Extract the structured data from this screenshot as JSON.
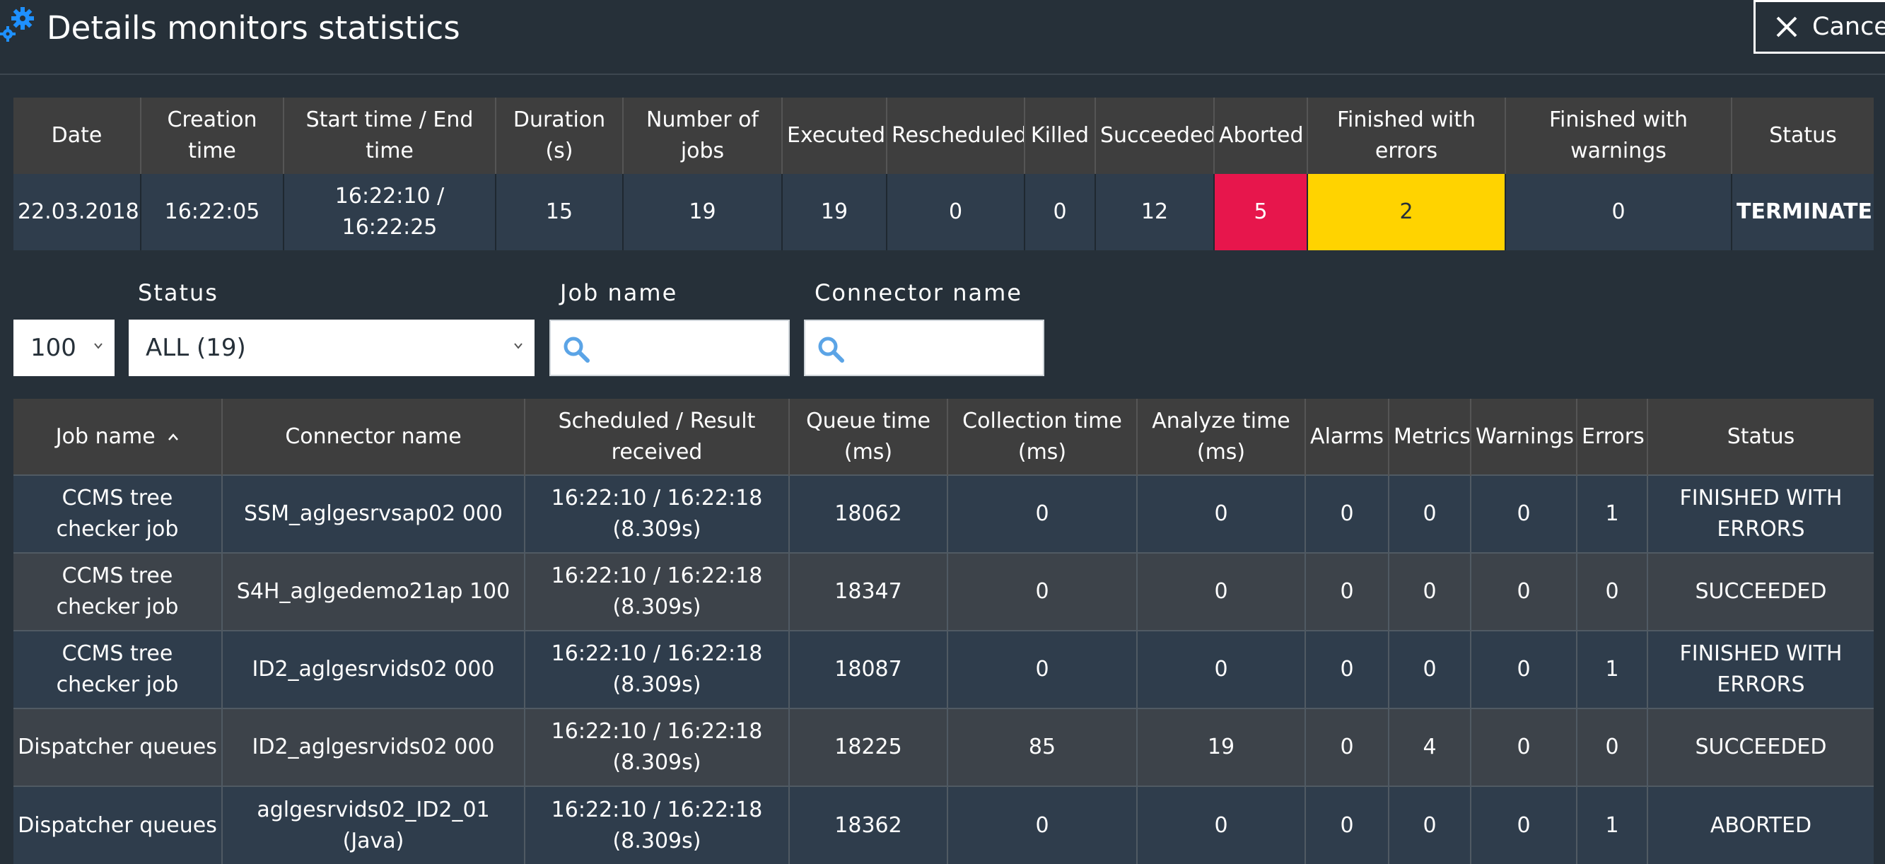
{
  "header": {
    "title": "Details monitors statistics",
    "cancel_label": "Cancel"
  },
  "summary": {
    "headers": [
      "Date",
      "Creation time",
      "Start time / End time",
      "Duration (s)",
      "Number of jobs",
      "Executed",
      "Rescheduled",
      "Killed",
      "Succeeded",
      "Aborted",
      "Finished with errors",
      "Finished with warnings",
      "Status"
    ],
    "row": [
      "22.03.2018",
      "16:22:05",
      "16:22:10 / 16:22:25",
      "15",
      "19",
      "19",
      "0",
      "0",
      "12",
      "5",
      "2",
      "0",
      "TERMINATED"
    ]
  },
  "filters": {
    "page_size": "100",
    "status_label": "Status",
    "status_value": "ALL (19)",
    "job_name_label": "Job name",
    "job_name_value": "",
    "connector_name_label": "Connector name",
    "connector_name_value": ""
  },
  "jobs": {
    "headers": [
      "Job name",
      "Connector name",
      "Scheduled / Result received",
      "Queue time (ms)",
      "Collection time (ms)",
      "Analyze time (ms)",
      "Alarms",
      "Metrics",
      "Warnings",
      "Errors",
      "Status"
    ],
    "rows": [
      [
        "CCMS tree checker job",
        "SSM_aglgesrvsap02 000",
        "16:22:10 / 16:22:18 (8.309s)",
        "18062",
        "0",
        "0",
        "0",
        "0",
        "0",
        "1",
        "FINISHED WITH ERRORS"
      ],
      [
        "CCMS tree checker job",
        "S4H_aglgedemo21ap 100",
        "16:22:10 / 16:22:18 (8.309s)",
        "18347",
        "0",
        "0",
        "0",
        "0",
        "0",
        "0",
        "SUCCEEDED"
      ],
      [
        "CCMS tree checker job",
        "ID2_aglgesrvids02 000",
        "16:22:10 / 16:22:18 (8.309s)",
        "18087",
        "0",
        "0",
        "0",
        "0",
        "0",
        "1",
        "FINISHED WITH ERRORS"
      ],
      [
        "Dispatcher queues",
        "ID2_aglgesrvids02 000",
        "16:22:10 / 16:22:18 (8.309s)",
        "18225",
        "85",
        "19",
        "0",
        "4",
        "0",
        "0",
        "SUCCEEDED"
      ],
      [
        "Dispatcher queues",
        "aglgesrvids02_ID2_01 (Java)",
        "16:22:10 / 16:22:18 (8.309s)",
        "18362",
        "0",
        "0",
        "0",
        "0",
        "0",
        "1",
        "ABORTED"
      ]
    ]
  },
  "icons": {
    "title": "gear-icon",
    "cancel": "close-icon",
    "search": "search-icon",
    "dropdown": "chevron-down-icon",
    "sort": "sort-ascending-icon"
  },
  "colors": {
    "background": "#263039",
    "aborted": "#e7164c",
    "finished_with_errors": "#ffd300",
    "accent": "#1e90ff"
  }
}
